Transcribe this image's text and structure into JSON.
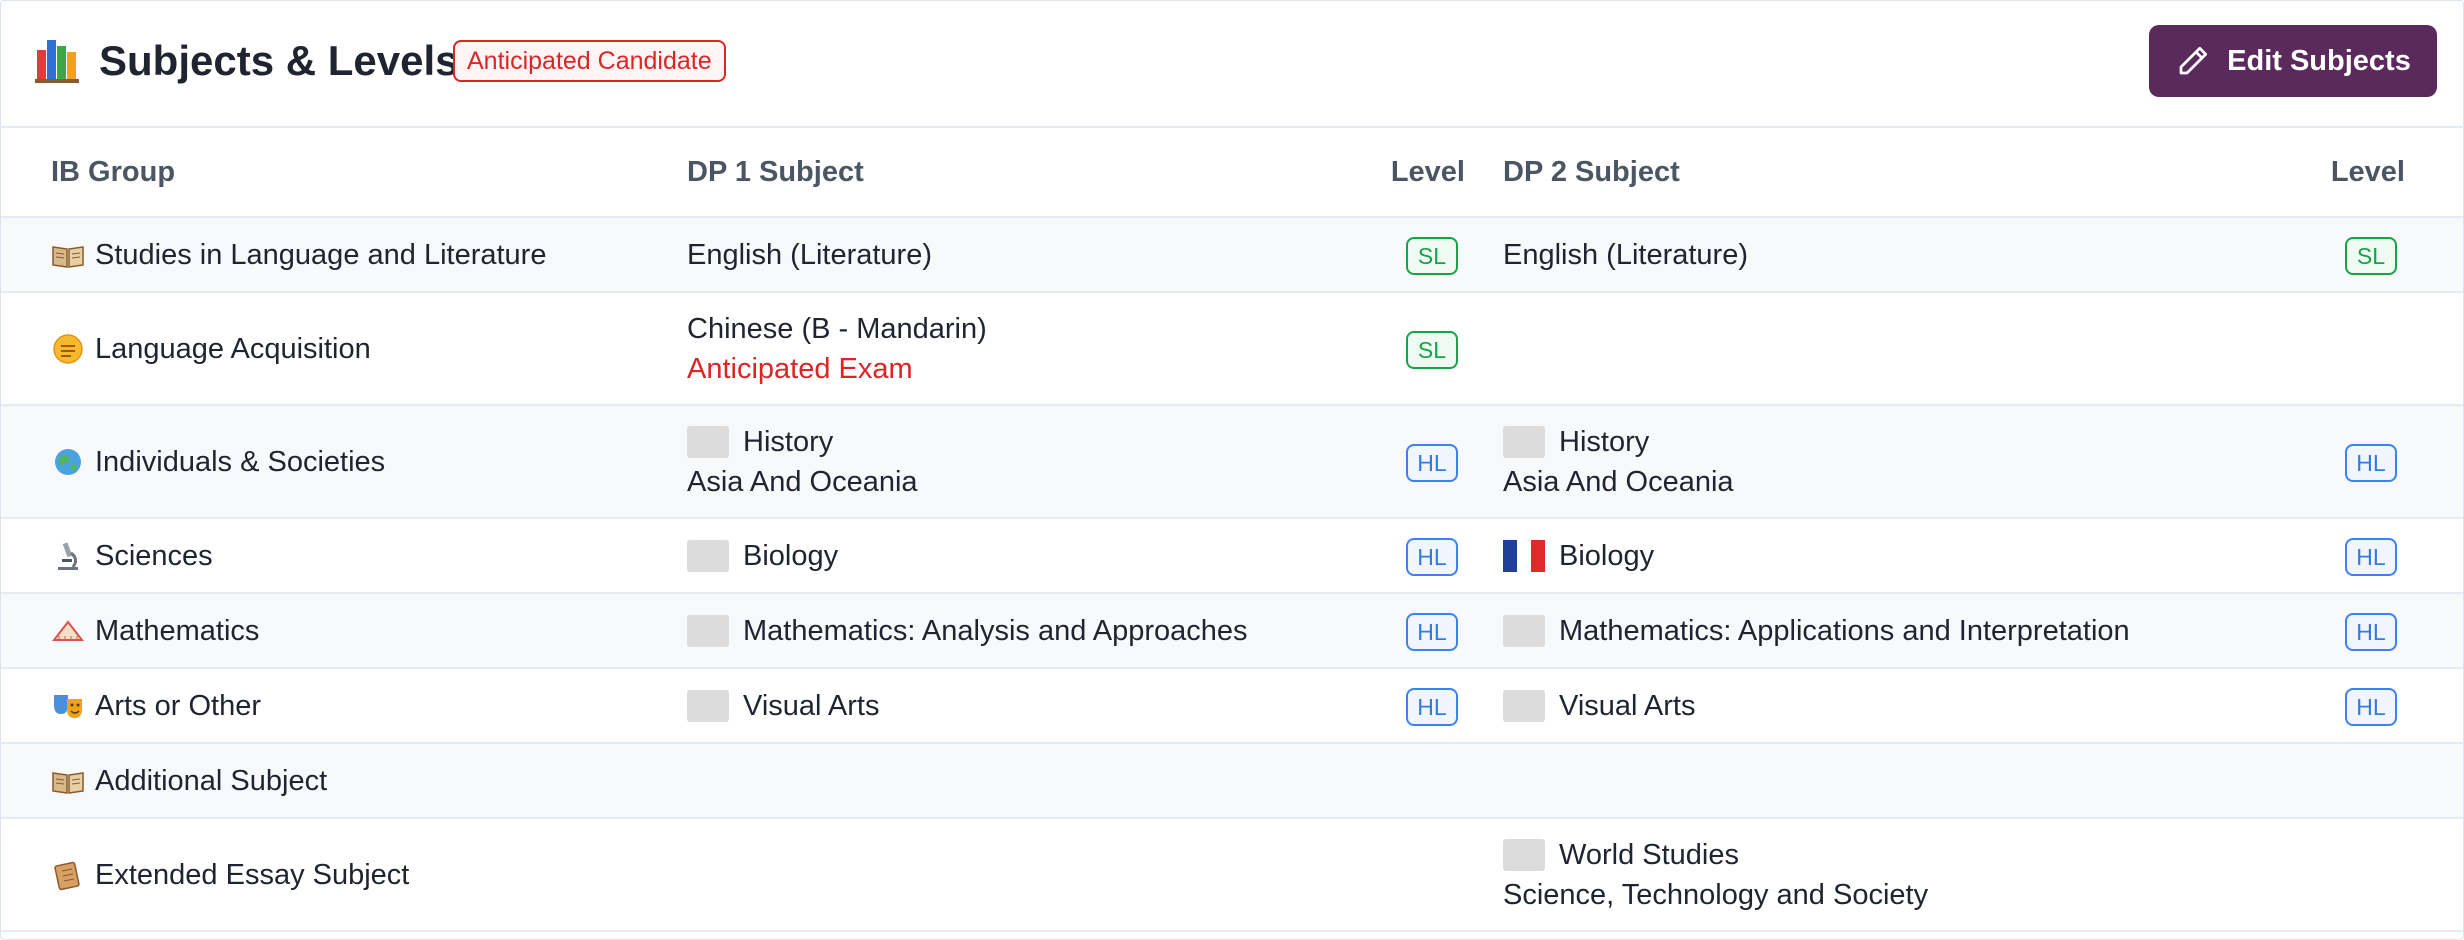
{
  "header": {
    "title": "Subjects & Levels",
    "badge": "Anticipated Candidate",
    "edit_button": "Edit Subjects",
    "books_icon": "books-icon",
    "edit_icon": "pencil-icon"
  },
  "columns": {
    "group": "IB Group",
    "dp1": "DP 1 Subject",
    "level1": "Level",
    "dp2": "DP 2 Subject",
    "level2": "Level"
  },
  "rows": [
    {
      "group": "Studies in Language and Literature",
      "icon": "open-book-icon",
      "dp1": {
        "flag": "",
        "subject": "English (Literature)",
        "detail": "",
        "level": "SL"
      },
      "dp2": {
        "flag": "",
        "subject": "English (Literature)",
        "detail": "",
        "level": "SL"
      }
    },
    {
      "group": "Language Acquisition",
      "icon": "speech-bubble-icon",
      "dp1": {
        "flag": "",
        "subject": "Chinese (B - Mandarin)",
        "detail": "Anticipated Exam",
        "level": "SL"
      },
      "dp2": {
        "flag": "",
        "subject": "",
        "detail": "",
        "level": ""
      }
    },
    {
      "group": "Individuals & Societies",
      "icon": "globe-icon",
      "dp1": {
        "flag": "placeholder",
        "subject": "History",
        "detail": "Asia And Oceania",
        "level": "HL"
      },
      "dp2": {
        "flag": "placeholder",
        "subject": "History",
        "detail": "Asia And Oceania",
        "level": "HL"
      }
    },
    {
      "group": "Sciences",
      "icon": "microscope-icon",
      "dp1": {
        "flag": "placeholder",
        "subject": "Biology",
        "detail": "",
        "level": "HL"
      },
      "dp2": {
        "flag": "france",
        "subject": "Biology",
        "detail": "",
        "level": "HL"
      }
    },
    {
      "group": "Mathematics",
      "icon": "triangle-ruler-icon",
      "dp1": {
        "flag": "placeholder",
        "subject": "Mathematics: Analysis and Approaches",
        "detail": "",
        "level": "HL"
      },
      "dp2": {
        "flag": "placeholder",
        "subject": "Mathematics: Applications and Interpretation",
        "detail": "",
        "level": "HL"
      }
    },
    {
      "group": "Arts or Other",
      "icon": "theater-masks-icon",
      "dp1": {
        "flag": "placeholder",
        "subject": "Visual Arts",
        "detail": "",
        "level": "HL"
      },
      "dp2": {
        "flag": "placeholder",
        "subject": "Visual Arts",
        "detail": "",
        "level": "HL"
      }
    },
    {
      "group": "Additional Subject",
      "icon": "open-book-icon",
      "dp1": {
        "flag": "",
        "subject": "",
        "detail": "",
        "level": ""
      },
      "dp2": {
        "flag": "",
        "subject": "",
        "detail": "",
        "level": ""
      }
    },
    {
      "group": "Extended Essay Subject",
      "icon": "scroll-icon",
      "dp1": {
        "flag": "",
        "subject": "",
        "detail": "",
        "level": ""
      },
      "dp2": {
        "flag": "placeholder",
        "subject": "World Studies",
        "detail": "Science, Technology and Society",
        "level": ""
      }
    }
  ]
}
